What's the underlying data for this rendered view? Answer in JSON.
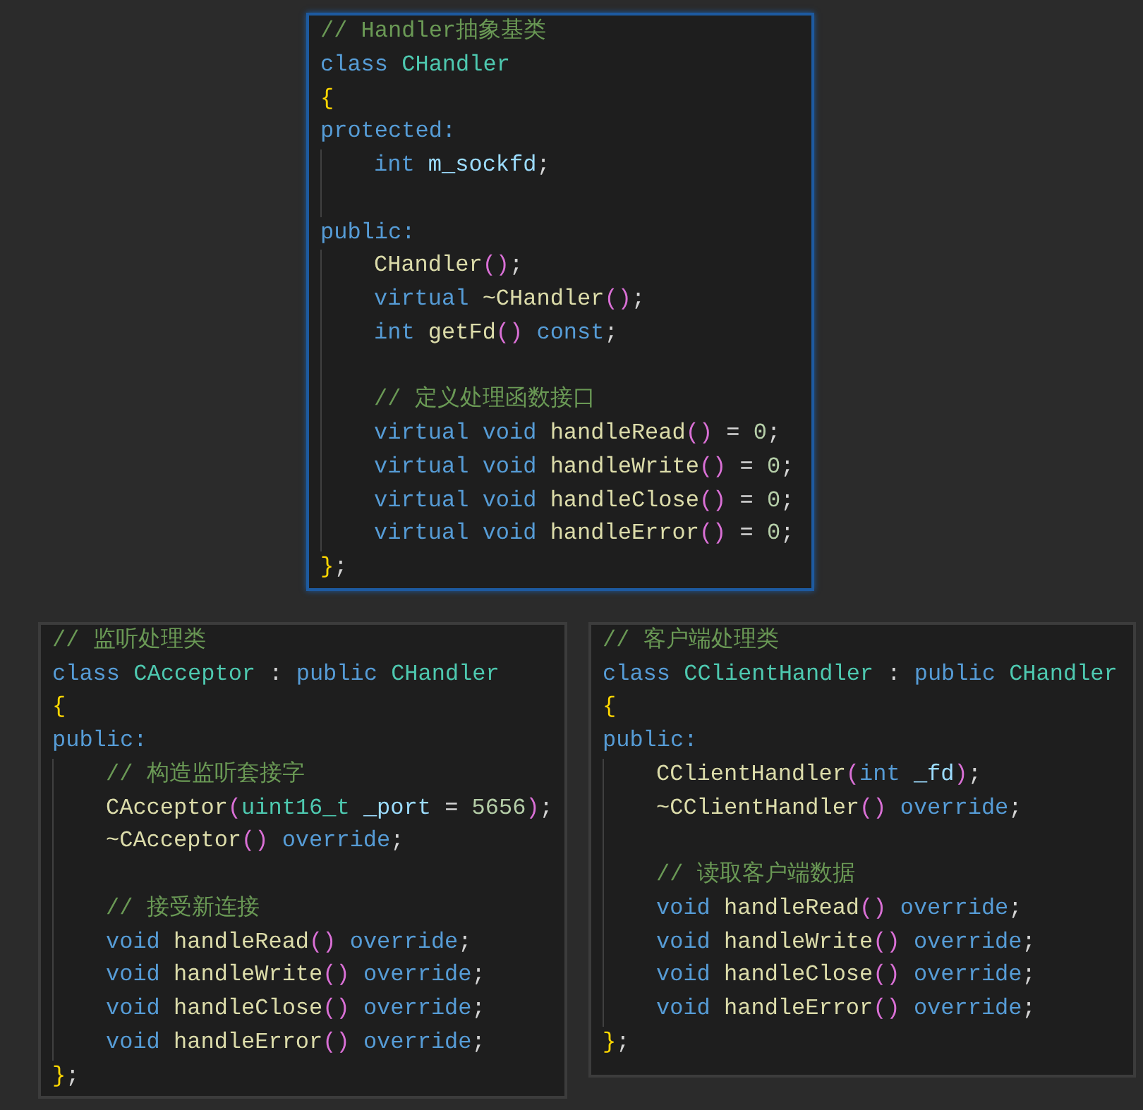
{
  "panels": [
    {
      "focused": true,
      "lines": [
        {
          "kind": "code",
          "tokens": [
            {
              "text": "// Handler抽象基类",
              "kind": "comment"
            }
          ]
        },
        {
          "kind": "code",
          "tokens": [
            {
              "text": "class ",
              "kind": "keyword"
            },
            {
              "text": "CHandler",
              "kind": "type"
            }
          ]
        },
        {
          "kind": "code",
          "tokens": [
            {
              "text": "{",
              "kind": "brace"
            }
          ]
        },
        {
          "kind": "code",
          "tokens": [
            {
              "text": "protected:",
              "kind": "keyword"
            }
          ],
          "children": [
            {
              "kind": "code",
              "tokens": [
                {
                  "text": "int ",
                  "kind": "keyword"
                },
                {
                  "text": "m_sockfd",
                  "kind": "variable"
                },
                {
                  "text": ";",
                  "kind": "plain"
                }
              ]
            },
            {
              "kind": "blank"
            }
          ]
        },
        {
          "kind": "code",
          "tokens": [
            {
              "text": "public:",
              "kind": "keyword"
            }
          ],
          "children": [
            {
              "kind": "code",
              "tokens": [
                {
                  "text": "CHandler",
                  "kind": "function"
                },
                {
                  "text": "()",
                  "kind": "paren"
                },
                {
                  "text": ";",
                  "kind": "plain"
                }
              ]
            },
            {
              "kind": "code",
              "tokens": [
                {
                  "text": "virtual ",
                  "kind": "keyword"
                },
                {
                  "text": "~CHandler",
                  "kind": "function"
                },
                {
                  "text": "()",
                  "kind": "paren"
                },
                {
                  "text": ";",
                  "kind": "plain"
                }
              ]
            },
            {
              "kind": "code",
              "tokens": [
                {
                  "text": "int ",
                  "kind": "keyword"
                },
                {
                  "text": "getFd",
                  "kind": "function"
                },
                {
                  "text": "()",
                  "kind": "paren"
                },
                {
                  "text": " const",
                  "kind": "keyword"
                },
                {
                  "text": ";",
                  "kind": "plain"
                }
              ]
            },
            {
              "kind": "blank"
            },
            {
              "kind": "code",
              "tokens": [
                {
                  "text": "// 定义处理函数接口",
                  "kind": "comment"
                }
              ]
            },
            {
              "kind": "code",
              "tokens": [
                {
                  "text": "virtual void ",
                  "kind": "keyword"
                },
                {
                  "text": "handleRead",
                  "kind": "function"
                },
                {
                  "text": "()",
                  "kind": "paren"
                },
                {
                  "text": " = ",
                  "kind": "plain"
                },
                {
                  "text": "0",
                  "kind": "number"
                },
                {
                  "text": ";",
                  "kind": "plain"
                }
              ]
            },
            {
              "kind": "code",
              "tokens": [
                {
                  "text": "virtual void ",
                  "kind": "keyword"
                },
                {
                  "text": "handleWrite",
                  "kind": "function"
                },
                {
                  "text": "()",
                  "kind": "paren"
                },
                {
                  "text": " = ",
                  "kind": "plain"
                },
                {
                  "text": "0",
                  "kind": "number"
                },
                {
                  "text": ";",
                  "kind": "plain"
                }
              ]
            },
            {
              "kind": "code",
              "tokens": [
                {
                  "text": "virtual void ",
                  "kind": "keyword"
                },
                {
                  "text": "handleClose",
                  "kind": "function"
                },
                {
                  "text": "()",
                  "kind": "paren"
                },
                {
                  "text": " = ",
                  "kind": "plain"
                },
                {
                  "text": "0",
                  "kind": "number"
                },
                {
                  "text": ";",
                  "kind": "plain"
                }
              ]
            },
            {
              "kind": "code",
              "tokens": [
                {
                  "text": "virtual void ",
                  "kind": "keyword"
                },
                {
                  "text": "handleError",
                  "kind": "function"
                },
                {
                  "text": "()",
                  "kind": "paren"
                },
                {
                  "text": " = ",
                  "kind": "plain"
                },
                {
                  "text": "0",
                  "kind": "number"
                },
                {
                  "text": ";",
                  "kind": "plain"
                }
              ]
            }
          ]
        },
        {
          "kind": "code",
          "tokens": [
            {
              "text": "}",
              "kind": "brace"
            },
            {
              "text": ";",
              "kind": "plain"
            }
          ]
        }
      ]
    },
    {
      "focused": false,
      "lines": [
        {
          "kind": "code",
          "tokens": [
            {
              "text": "// 监听处理类",
              "kind": "comment"
            }
          ]
        },
        {
          "kind": "code",
          "tokens": [
            {
              "text": "class ",
              "kind": "keyword"
            },
            {
              "text": "CAcceptor",
              "kind": "type"
            },
            {
              "text": " : ",
              "kind": "plain"
            },
            {
              "text": "public ",
              "kind": "keyword"
            },
            {
              "text": "CHandler",
              "kind": "type"
            }
          ]
        },
        {
          "kind": "code",
          "tokens": [
            {
              "text": "{",
              "kind": "brace"
            }
          ]
        },
        {
          "kind": "code",
          "tokens": [
            {
              "text": "public:",
              "kind": "keyword"
            }
          ],
          "children": [
            {
              "kind": "code",
              "tokens": [
                {
                  "text": "// 构造监听套接字",
                  "kind": "comment"
                }
              ]
            },
            {
              "kind": "code",
              "tokens": [
                {
                  "text": "CAcceptor",
                  "kind": "function"
                },
                {
                  "text": "(",
                  "kind": "paren"
                },
                {
                  "text": "uint16_t ",
                  "kind": "type"
                },
                {
                  "text": "_port",
                  "kind": "variable"
                },
                {
                  "text": " = ",
                  "kind": "plain"
                },
                {
                  "text": "5656",
                  "kind": "number"
                },
                {
                  "text": ")",
                  "kind": "paren"
                },
                {
                  "text": ";",
                  "kind": "plain"
                }
              ]
            },
            {
              "kind": "code",
              "tokens": [
                {
                  "text": "~CAcceptor",
                  "kind": "function"
                },
                {
                  "text": "()",
                  "kind": "paren"
                },
                {
                  "text": " override",
                  "kind": "keyword"
                },
                {
                  "text": ";",
                  "kind": "plain"
                }
              ]
            },
            {
              "kind": "blank"
            },
            {
              "kind": "code",
              "tokens": [
                {
                  "text": "// 接受新连接",
                  "kind": "comment"
                }
              ]
            },
            {
              "kind": "code",
              "tokens": [
                {
                  "text": "void ",
                  "kind": "keyword"
                },
                {
                  "text": "handleRead",
                  "kind": "function"
                },
                {
                  "text": "()",
                  "kind": "paren"
                },
                {
                  "text": " override",
                  "kind": "keyword"
                },
                {
                  "text": ";",
                  "kind": "plain"
                }
              ]
            },
            {
              "kind": "code",
              "tokens": [
                {
                  "text": "void ",
                  "kind": "keyword"
                },
                {
                  "text": "handleWrite",
                  "kind": "function"
                },
                {
                  "text": "()",
                  "kind": "paren"
                },
                {
                  "text": " override",
                  "kind": "keyword"
                },
                {
                  "text": ";",
                  "kind": "plain"
                }
              ]
            },
            {
              "kind": "code",
              "tokens": [
                {
                  "text": "void ",
                  "kind": "keyword"
                },
                {
                  "text": "handleClose",
                  "kind": "function"
                },
                {
                  "text": "()",
                  "kind": "paren"
                },
                {
                  "text": " override",
                  "kind": "keyword"
                },
                {
                  "text": ";",
                  "kind": "plain"
                }
              ]
            },
            {
              "kind": "code",
              "tokens": [
                {
                  "text": "void ",
                  "kind": "keyword"
                },
                {
                  "text": "handleError",
                  "kind": "function"
                },
                {
                  "text": "()",
                  "kind": "paren"
                },
                {
                  "text": " override",
                  "kind": "keyword"
                },
                {
                  "text": ";",
                  "kind": "plain"
                }
              ]
            }
          ]
        },
        {
          "kind": "code",
          "tokens": [
            {
              "text": "}",
              "kind": "brace"
            },
            {
              "text": ";",
              "kind": "plain"
            }
          ]
        }
      ]
    },
    {
      "focused": false,
      "lines": [
        {
          "kind": "code",
          "tokens": [
            {
              "text": "// 客户端处理类",
              "kind": "comment"
            }
          ]
        },
        {
          "kind": "code",
          "tokens": [
            {
              "text": "class ",
              "kind": "keyword"
            },
            {
              "text": "CClientHandler",
              "kind": "type"
            },
            {
              "text": " : ",
              "kind": "plain"
            },
            {
              "text": "public ",
              "kind": "keyword"
            },
            {
              "text": "CHandler",
              "kind": "type"
            }
          ]
        },
        {
          "kind": "code",
          "tokens": [
            {
              "text": "{",
              "kind": "brace"
            }
          ]
        },
        {
          "kind": "code",
          "tokens": [
            {
              "text": "public:",
              "kind": "keyword"
            }
          ],
          "children": [
            {
              "kind": "code",
              "tokens": [
                {
                  "text": "CClientHandler",
                  "kind": "function"
                },
                {
                  "text": "(",
                  "kind": "paren"
                },
                {
                  "text": "int ",
                  "kind": "keyword"
                },
                {
                  "text": "_fd",
                  "kind": "variable"
                },
                {
                  "text": ")",
                  "kind": "paren"
                },
                {
                  "text": ";",
                  "kind": "plain"
                }
              ]
            },
            {
              "kind": "code",
              "tokens": [
                {
                  "text": "~CClientHandler",
                  "kind": "function"
                },
                {
                  "text": "()",
                  "kind": "paren"
                },
                {
                  "text": " override",
                  "kind": "keyword"
                },
                {
                  "text": ";",
                  "kind": "plain"
                }
              ]
            },
            {
              "kind": "blank"
            },
            {
              "kind": "code",
              "tokens": [
                {
                  "text": "// 读取客户端数据",
                  "kind": "comment"
                }
              ]
            },
            {
              "kind": "code",
              "tokens": [
                {
                  "text": "void ",
                  "kind": "keyword"
                },
                {
                  "text": "handleRead",
                  "kind": "function"
                },
                {
                  "text": "()",
                  "kind": "paren"
                },
                {
                  "text": " override",
                  "kind": "keyword"
                },
                {
                  "text": ";",
                  "kind": "plain"
                }
              ]
            },
            {
              "kind": "code",
              "tokens": [
                {
                  "text": "void ",
                  "kind": "keyword"
                },
                {
                  "text": "handleWrite",
                  "kind": "function"
                },
                {
                  "text": "()",
                  "kind": "paren"
                },
                {
                  "text": " override",
                  "kind": "keyword"
                },
                {
                  "text": ";",
                  "kind": "plain"
                }
              ]
            },
            {
              "kind": "code",
              "tokens": [
                {
                  "text": "void ",
                  "kind": "keyword"
                },
                {
                  "text": "handleClose",
                  "kind": "function"
                },
                {
                  "text": "()",
                  "kind": "paren"
                },
                {
                  "text": " override",
                  "kind": "keyword"
                },
                {
                  "text": ";",
                  "kind": "plain"
                }
              ]
            },
            {
              "kind": "code",
              "tokens": [
                {
                  "text": "void ",
                  "kind": "keyword"
                },
                {
                  "text": "handleError",
                  "kind": "function"
                },
                {
                  "text": "()",
                  "kind": "paren"
                },
                {
                  "text": " override",
                  "kind": "keyword"
                },
                {
                  "text": ";",
                  "kind": "plain"
                }
              ]
            }
          ]
        },
        {
          "kind": "code",
          "tokens": [
            {
              "text": "}",
              "kind": "brace"
            },
            {
              "text": ";",
              "kind": "plain"
            }
          ]
        }
      ]
    }
  ]
}
